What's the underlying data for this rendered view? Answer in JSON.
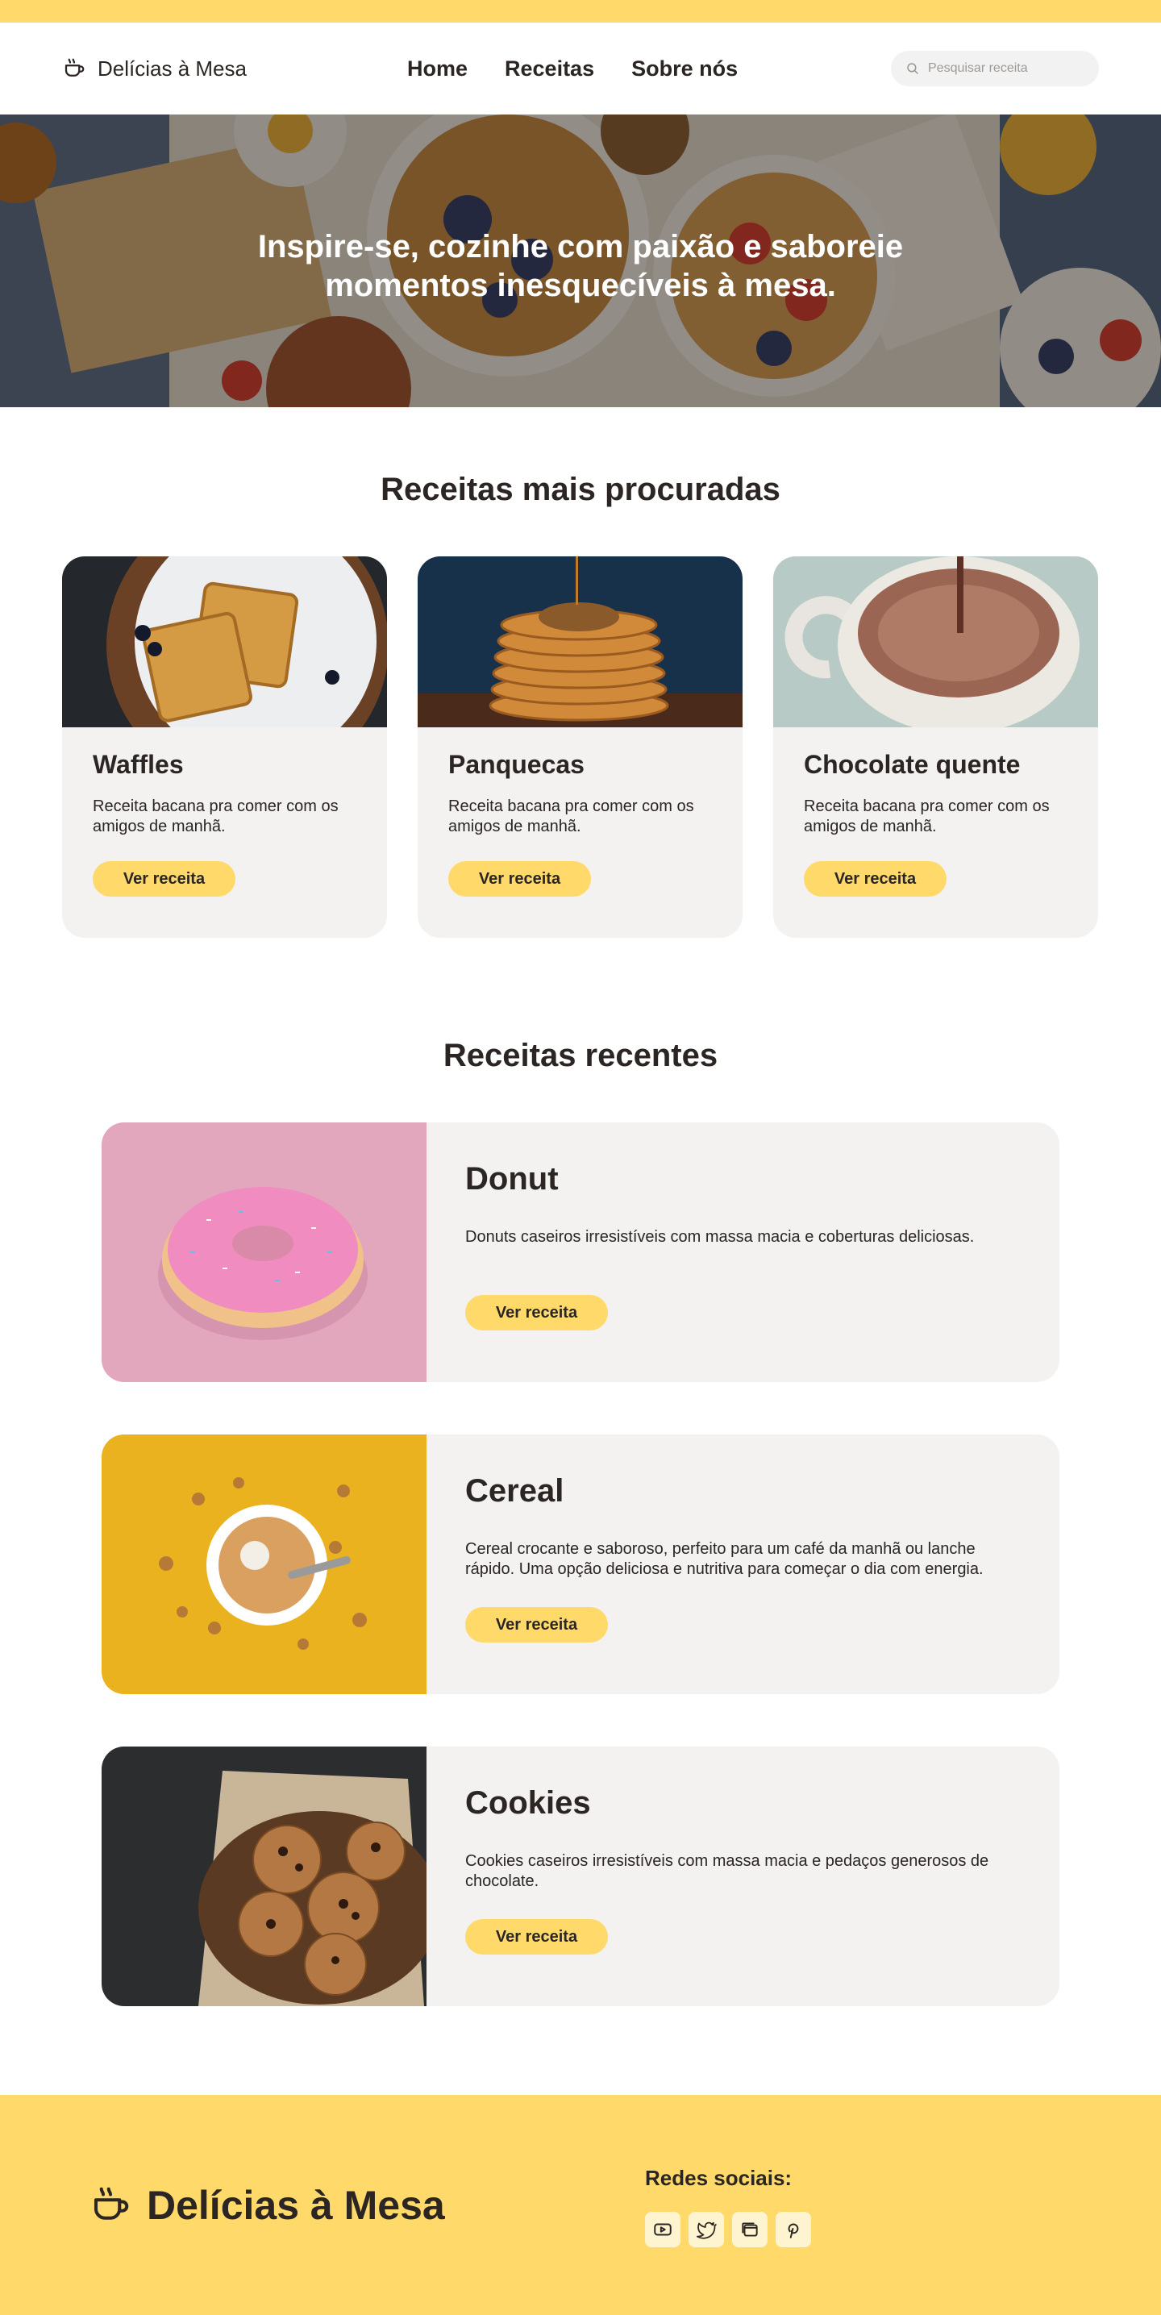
{
  "header": {
    "brand": "Delícias à Mesa",
    "nav": [
      "Home",
      "Receitas",
      "Sobre nós"
    ],
    "search_placeholder": "Pesquisar receita"
  },
  "hero": {
    "headline": "Inspire-se, cozinhe com paixão e saboreie momentos inesquecíveis à mesa."
  },
  "popular": {
    "title": "Receitas mais procuradas",
    "cards": [
      {
        "title": "Waffles",
        "description": "Receita bacana pra comer com os amigos de manhã.",
        "button": "Ver receita"
      },
      {
        "title": "Panquecas",
        "description": "Receita bacana pra comer com os amigos de manhã.",
        "button": "Ver receita"
      },
      {
        "title": "Chocolate quente",
        "description": "Receita bacana pra comer com os amigos de manhã.",
        "button": "Ver receita"
      }
    ]
  },
  "recent": {
    "title": "Receitas recentes",
    "items": [
      {
        "title": "Donut",
        "description": "Donuts caseiros irresistíveis com massa macia e coberturas deliciosas.",
        "button": "Ver receita"
      },
      {
        "title": "Cereal",
        "description": "Cereal crocante e saboroso, perfeito para um café da manhã ou lanche rápido. Uma opção deliciosa e nutritiva para começar o dia com energia.",
        "button": "Ver receita"
      },
      {
        "title": "Cookies",
        "description": "Cookies caseiros irresistíveis com massa macia e pedaços generosos de chocolate.",
        "button": "Ver receita"
      }
    ]
  },
  "footer": {
    "brand": "Delícias à Mesa",
    "social_title": "Redes sociais:",
    "social_icons": [
      "youtube-icon",
      "twitter-icon",
      "browser-icon",
      "pinterest-icon"
    ]
  },
  "colors": {
    "accent": "#ffda6a",
    "card_bg": "#f3f2f1",
    "text": "#2b2523"
  }
}
